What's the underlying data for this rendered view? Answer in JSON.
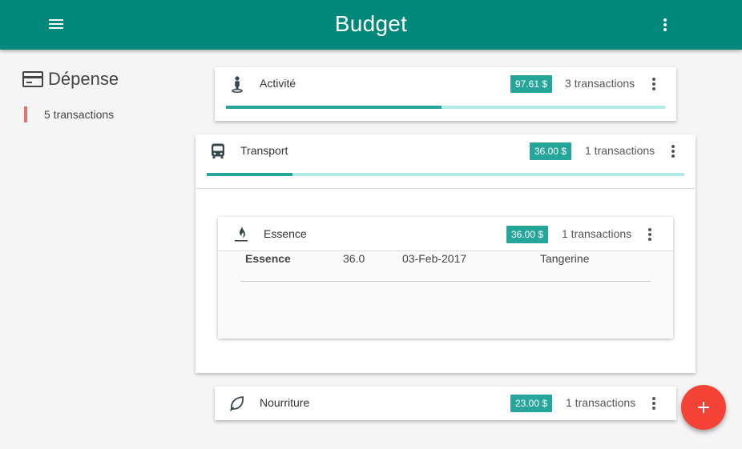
{
  "appbar": {
    "title": "Budget",
    "menu_icon": "hamburger-menu-icon",
    "more_icon": "more-vert-icon",
    "color": "#00897b"
  },
  "sidebar": {
    "title": "Dépense",
    "icon": "credit-card-icon",
    "count_label": "5 transactions",
    "accent": "#e57373"
  },
  "categories": [
    {
      "name": "Activité",
      "icon": "person-pin-icon",
      "amount": "97.61 $",
      "transactions": "3 transactions",
      "progress": 0.49
    },
    {
      "name": "Transport",
      "icon": "bus-icon",
      "amount": "36.00 $",
      "transactions": "1 transactions",
      "progress": 0.18,
      "subcategories": [
        {
          "name": "Essence",
          "icon": "fuel-flame-icon",
          "amount": "36.00 $",
          "transactions": "1 transactions",
          "rows": [
            {
              "name": "Essence",
              "amount": "36.0",
              "date": "03-Feb-2017",
              "account": "Tangerine"
            }
          ]
        }
      ]
    },
    {
      "name": "Nourriture",
      "icon": "leaf-icon",
      "amount": "23.00 $",
      "transactions": "1 transactions"
    }
  ],
  "fab": {
    "icon": "add-icon",
    "color": "#f44336"
  },
  "colors": {
    "amount_badge": "#26a69a",
    "progress_track": "#b2ebe6"
  }
}
